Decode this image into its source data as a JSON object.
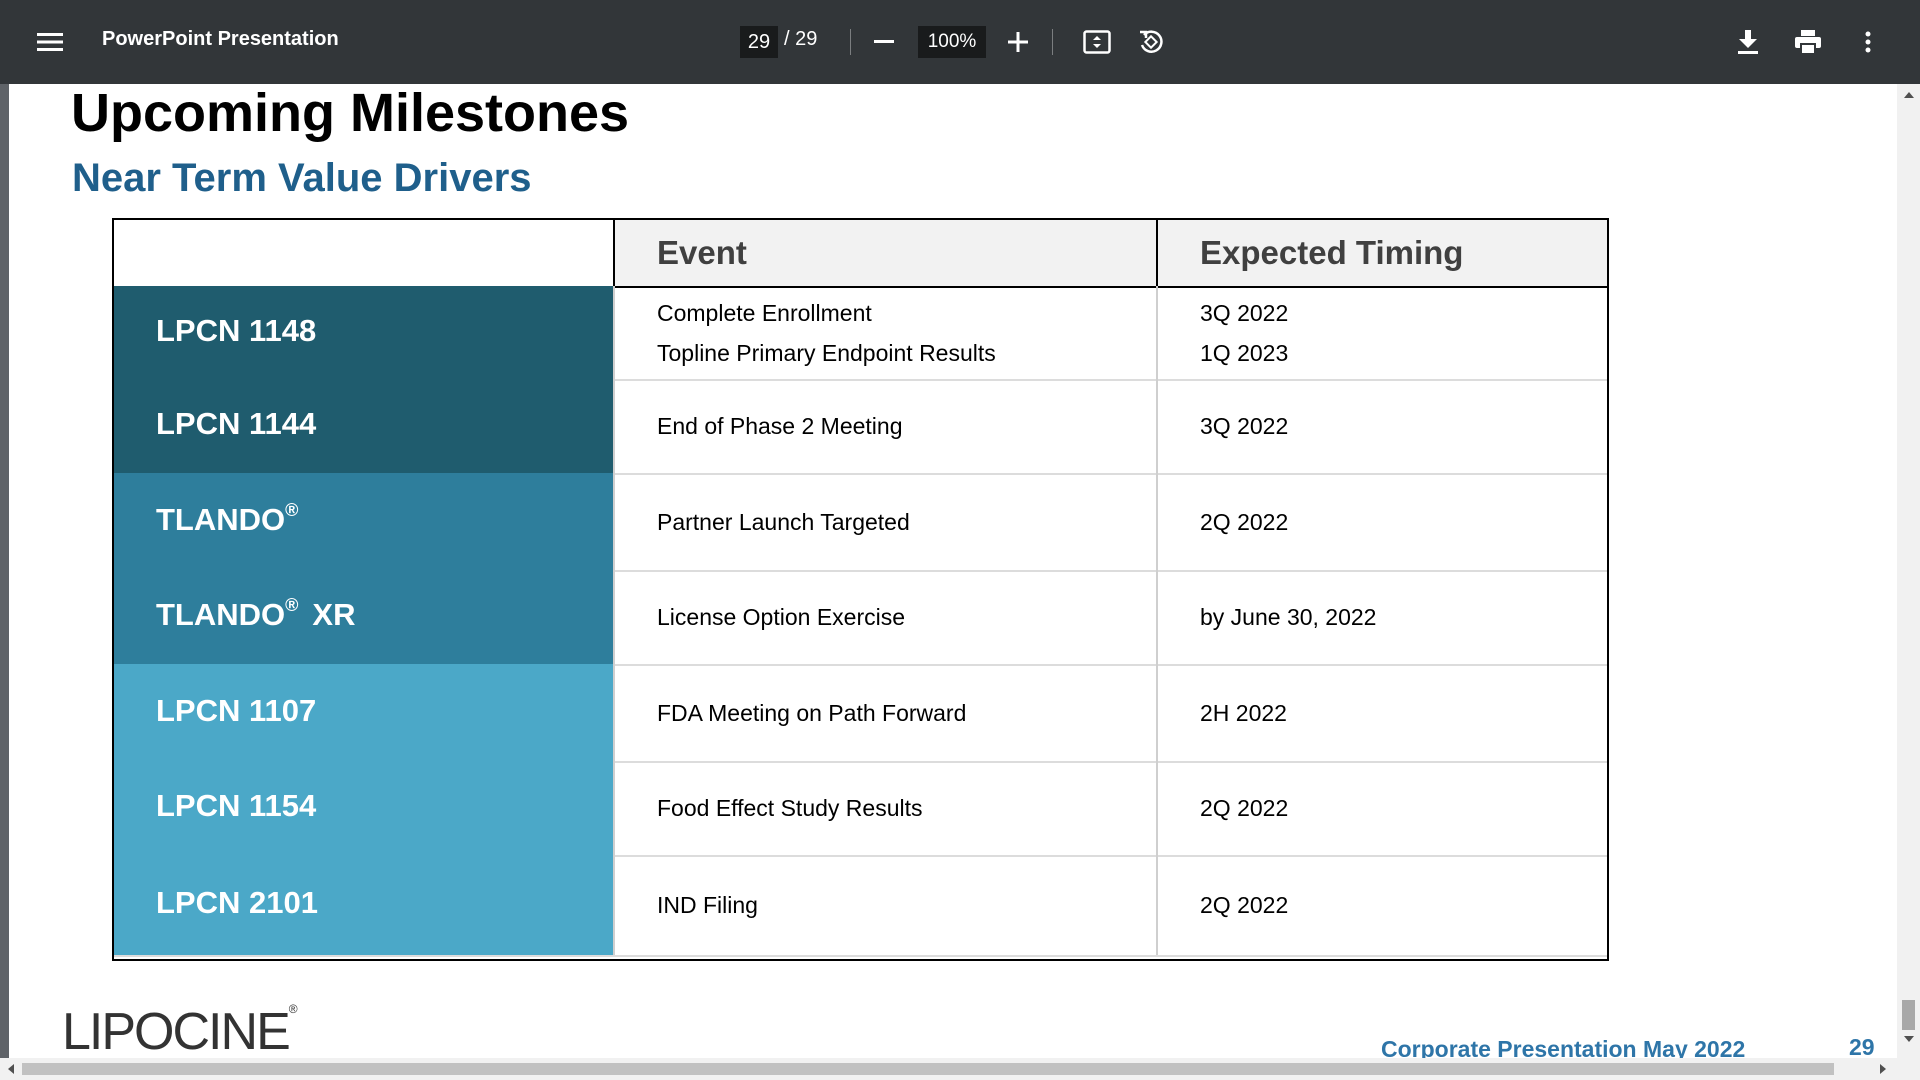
{
  "toolbar": {
    "menu_icon": "hamburger-menu-icon",
    "title": "PowerPoint Presentation",
    "current_page": "29",
    "page_separator": "/ 29",
    "zoom_value": "100%",
    "icons": {
      "zoom_out": "minus-icon",
      "zoom_in": "plus-icon",
      "fit": "fit-to-page-icon",
      "rotate": "rotate-icon",
      "download": "download-icon",
      "print": "print-icon",
      "more": "more-vertical-icon"
    }
  },
  "slide": {
    "title": "Upcoming Milestones",
    "subtitle": "Near Term Value Drivers",
    "table": {
      "headers": [
        "",
        "Event",
        "Expected Timing"
      ],
      "rows": [
        {
          "product": "LPCN 1148",
          "events": [
            "Complete Enrollment",
            "Topline Primary Endpoint Results"
          ],
          "timings": [
            "3Q 2022",
            "1Q 2023"
          ],
          "color": "#1f5c6e"
        },
        {
          "product": "LPCN 1144",
          "events": [
            "End of Phase 2 Meeting"
          ],
          "timings": [
            "3Q 2022"
          ],
          "color": "#1f5c6e"
        },
        {
          "product": "TLANDO",
          "product_sup": "®",
          "events": [
            "Partner Launch Targeted"
          ],
          "timings": [
            "2Q 2022"
          ],
          "color": "#2e7e9c"
        },
        {
          "product": "TLANDO",
          "product_sup": "®",
          "product_suffix": "XR",
          "events": [
            "License Option Exercise"
          ],
          "timings": [
            "by June 30, 2022"
          ],
          "color": "#2e7e9c"
        },
        {
          "product": "LPCN 1107",
          "events": [
            "FDA Meeting on Path Forward"
          ],
          "timings": [
            "2H 2022"
          ],
          "color": "#4ba8c8"
        },
        {
          "product": "LPCN 1154",
          "events": [
            "Food Effect Study Results"
          ],
          "timings": [
            "2Q 2022"
          ],
          "color": "#4ba8c8"
        },
        {
          "product": "LPCN 2101",
          "events": [
            "IND Filing"
          ],
          "timings": [
            "2Q 2022"
          ],
          "color": "#4ba8c8"
        }
      ]
    },
    "logo_text": "LIPOCIN",
    "logo_tail": "E",
    "logo_reg": "®",
    "footer": "Corporate Presentation May 2022",
    "page_number": "29"
  }
}
